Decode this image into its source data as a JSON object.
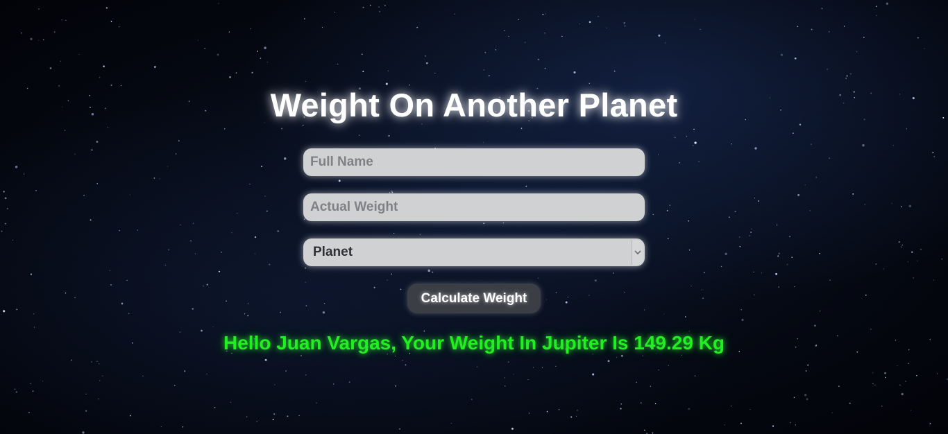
{
  "page": {
    "title": "Weight On Another Planet"
  },
  "form": {
    "name_placeholder": "Full Name",
    "weight_placeholder": "Actual Weight",
    "planet_selected": "Planet",
    "calculate_label": "Calculate Weight"
  },
  "result": {
    "message": "Hello Juan Vargas, Your Weight In Jupiter Is 149.29 Kg"
  },
  "colors": {
    "result_text": "#22ee22",
    "title_text": "#ffffff",
    "field_bg": "#d0d1d3",
    "button_bg": "#3b3e45"
  },
  "icons": {
    "select_arrow": "chevron-down-icon"
  }
}
